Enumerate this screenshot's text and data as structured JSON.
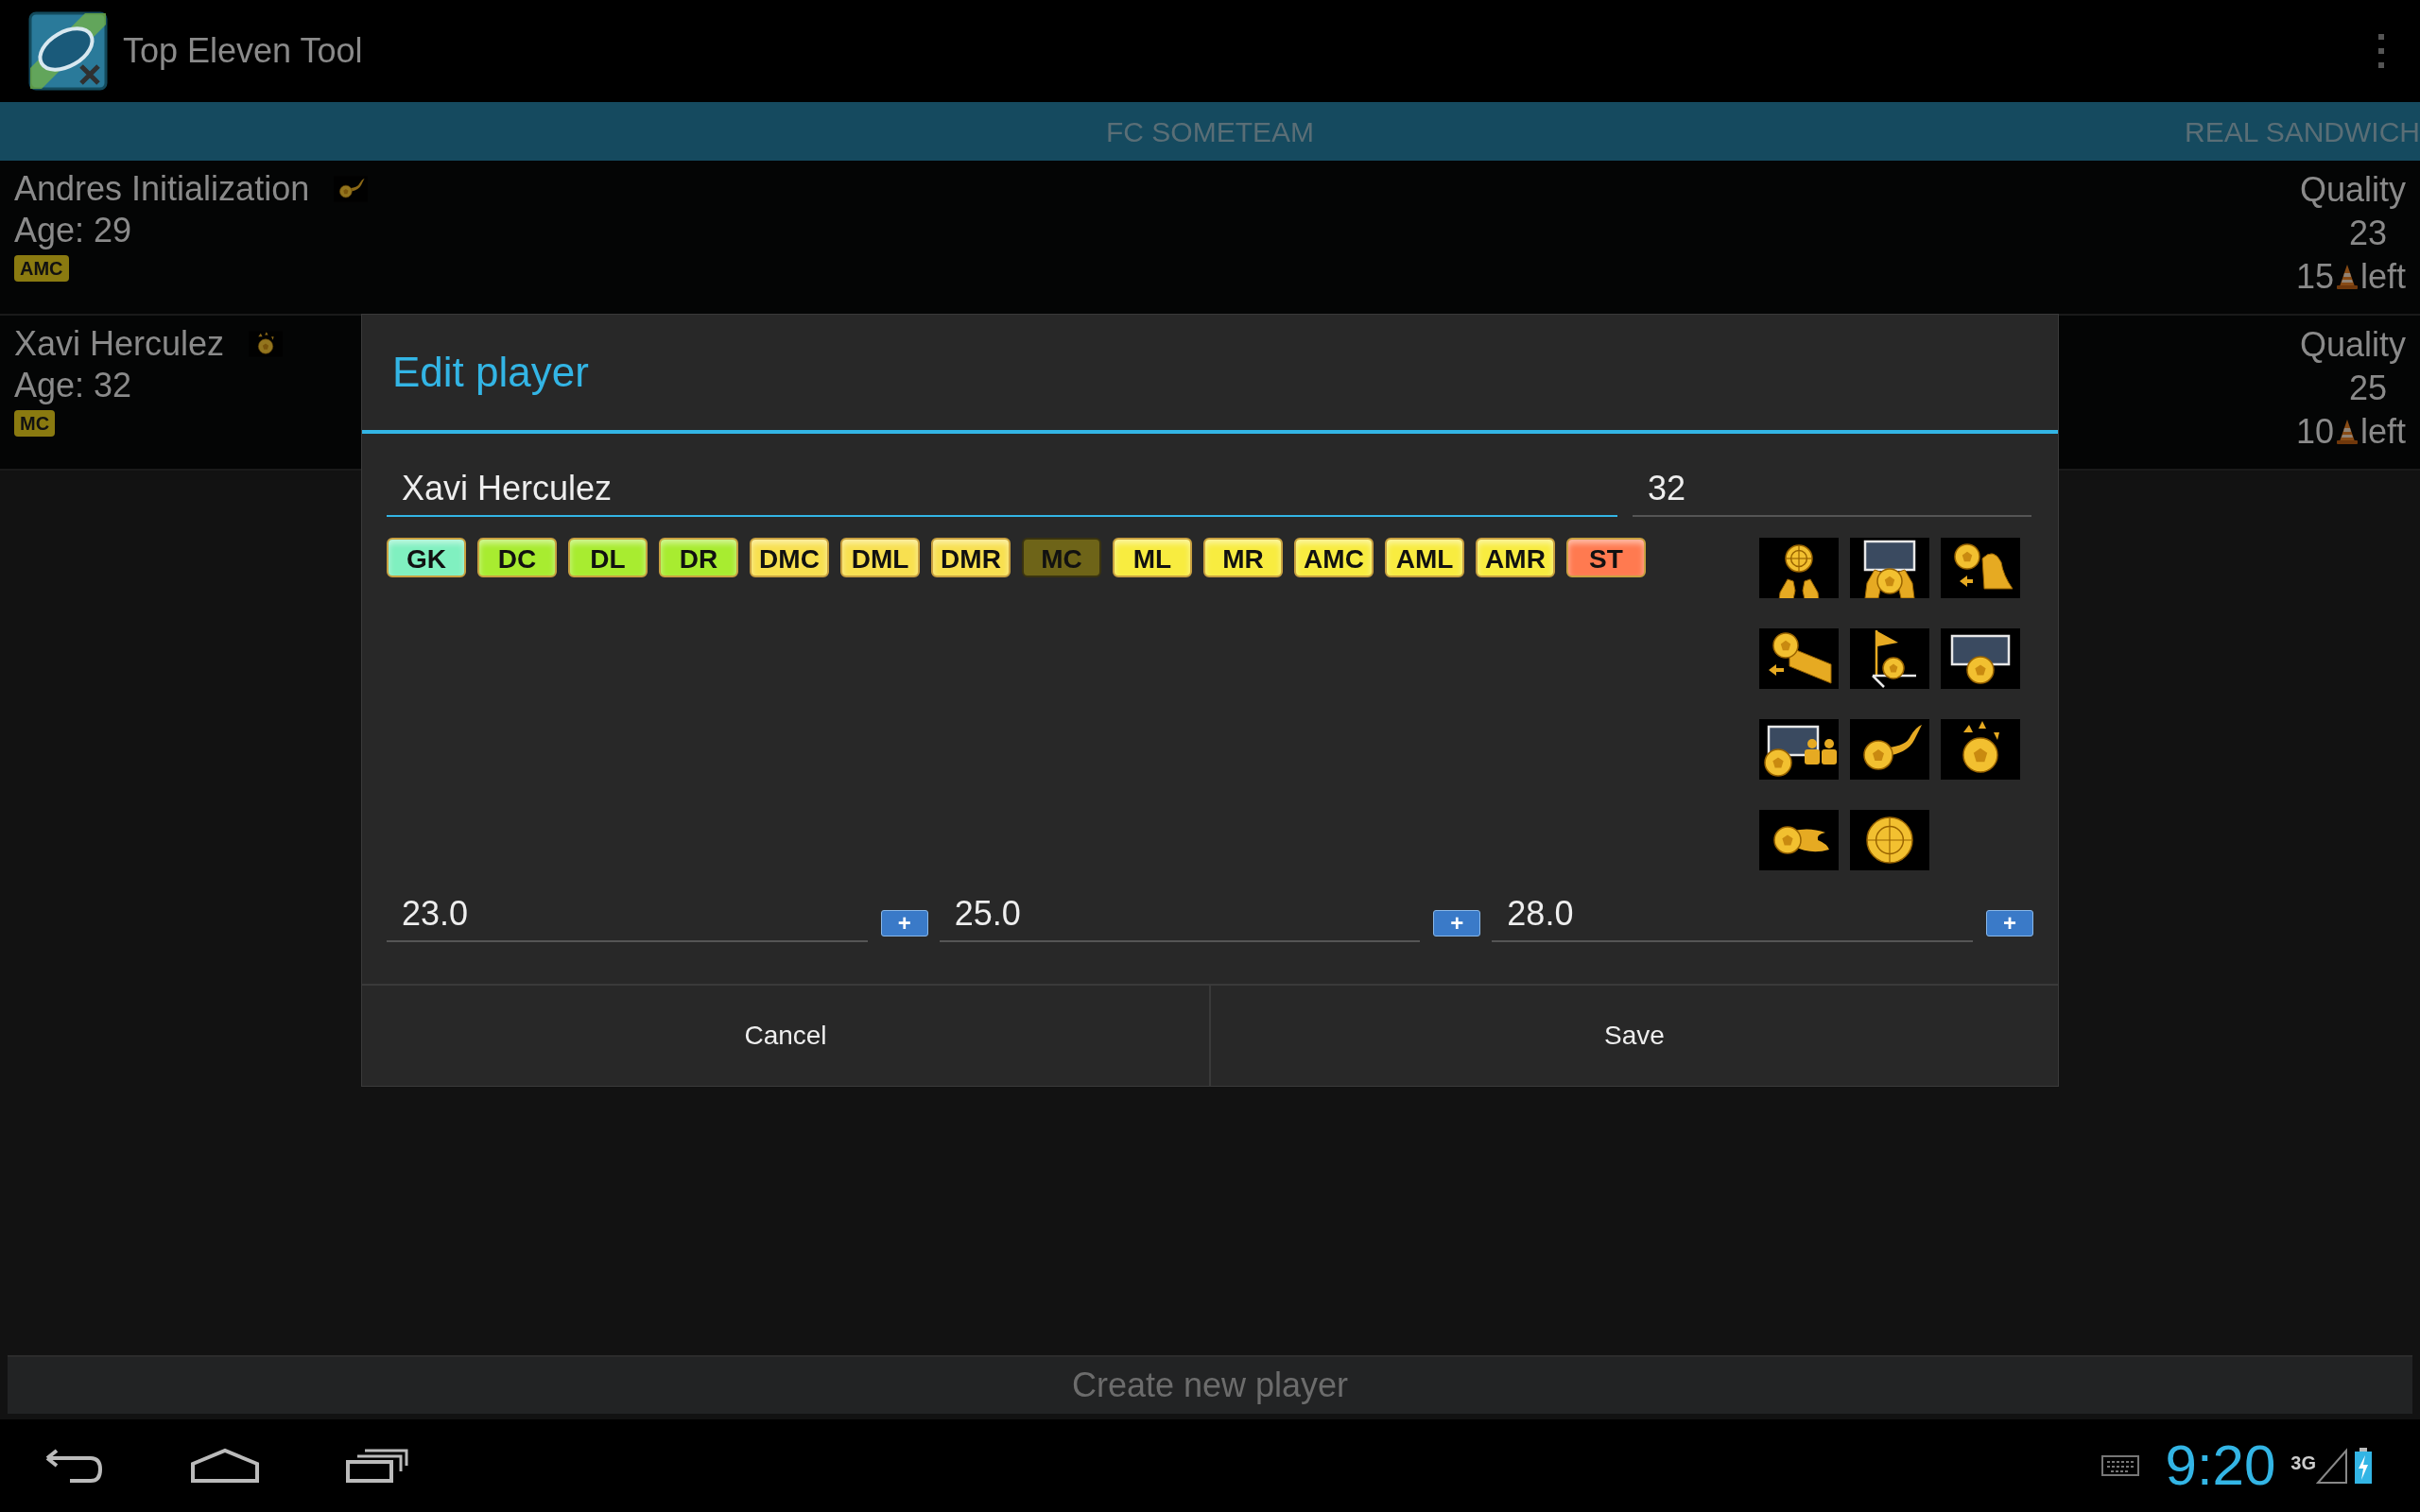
{
  "app_bar": {
    "title": "Top Eleven Tool"
  },
  "teams": [
    {
      "name": "FC SOMETEAM"
    },
    {
      "name": "REAL SANDWICH"
    }
  ],
  "players": [
    {
      "name": "Andres Initialization",
      "skill_icon": {
        "kind": "curve"
      },
      "age": "Age: 29",
      "position": "AMC",
      "quality_label": "Quality",
      "quality": "23",
      "left_count": "15",
      "left_label": "left"
    },
    {
      "name": "Xavi Herculez",
      "skill_icon": {
        "kind": "arrows"
      },
      "age": "Age: 32",
      "position": "MC",
      "quality_label": "Quality",
      "quality": "25",
      "left_count": "10",
      "left_label": "left"
    }
  ],
  "dialog": {
    "title": "Edit player",
    "name_value": "Xavi Herculez",
    "age_value": "32",
    "positions": [
      {
        "label": "GK",
        "color": "#80f0c0",
        "selected": false
      },
      {
        "label": "DC",
        "color": "#a8ec30",
        "selected": false
      },
      {
        "label": "DL",
        "color": "#a8ec30",
        "selected": false
      },
      {
        "label": "DR",
        "color": "#a8ec30",
        "selected": false
      },
      {
        "label": "DMC",
        "color": "#f8e050",
        "selected": false
      },
      {
        "label": "DML",
        "color": "#f8e050",
        "selected": false
      },
      {
        "label": "DMR",
        "color": "#f8e050",
        "selected": false
      },
      {
        "label": "MC",
        "color": "#6e6418",
        "selected": true
      },
      {
        "label": "ML",
        "color": "#f8ec40",
        "selected": false
      },
      {
        "label": "MR",
        "color": "#f8ec40",
        "selected": false
      },
      {
        "label": "AMC",
        "color": "#f8ec40",
        "selected": false
      },
      {
        "label": "AML",
        "color": "#f8ec40",
        "selected": false
      },
      {
        "label": "AMR",
        "color": "#f8ec40",
        "selected": false
      },
      {
        "label": "ST",
        "color": "#ff7a50",
        "selected": false
      }
    ],
    "skills": [
      {
        "kind": "gloves_target"
      },
      {
        "kind": "gloves_goal"
      },
      {
        "kind": "header"
      },
      {
        "kind": "wall"
      },
      {
        "kind": "corner"
      },
      {
        "kind": "goal"
      },
      {
        "kind": "goal_players"
      },
      {
        "kind": "curve"
      },
      {
        "kind": "arrows"
      },
      {
        "kind": "flame"
      },
      {
        "kind": "target"
      }
    ],
    "quality_fields": [
      {
        "value": "23.0",
        "button": "+"
      },
      {
        "value": "25.0",
        "button": "+"
      },
      {
        "value": "28.0",
        "button": "+"
      }
    ],
    "buttons": [
      "Cancel",
      "Save"
    ]
  },
  "create_button": "Create new player",
  "status_bar": {
    "time": "9:20",
    "network": "3G"
  }
}
